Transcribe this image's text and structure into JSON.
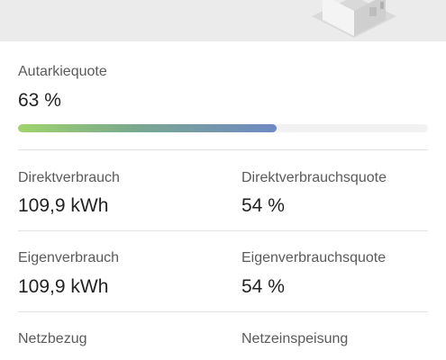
{
  "autarky": {
    "label": "Autarkiequote",
    "value": "63 %",
    "fraction": 0.63
  },
  "rows": [
    {
      "left": {
        "label": "Direktverbrauch",
        "value": "109,9 kWh"
      },
      "right": {
        "label": "Direktverbrauchsquote",
        "value": "54 %"
      }
    },
    {
      "left": {
        "label": "Eigenverbrauch",
        "value": "109,9 kWh"
      },
      "right": {
        "label": "Eigenverbrauchsquote",
        "value": "54 %"
      }
    },
    {
      "left": {
        "label": "Netzbezug",
        "value": ""
      },
      "right": {
        "label": "Netzeinspeisung",
        "value": ""
      }
    }
  ],
  "colors": {
    "bar_start": "#9fd46c",
    "bar_end": "#6f89c4"
  },
  "icons": {
    "house": "house-icon"
  }
}
